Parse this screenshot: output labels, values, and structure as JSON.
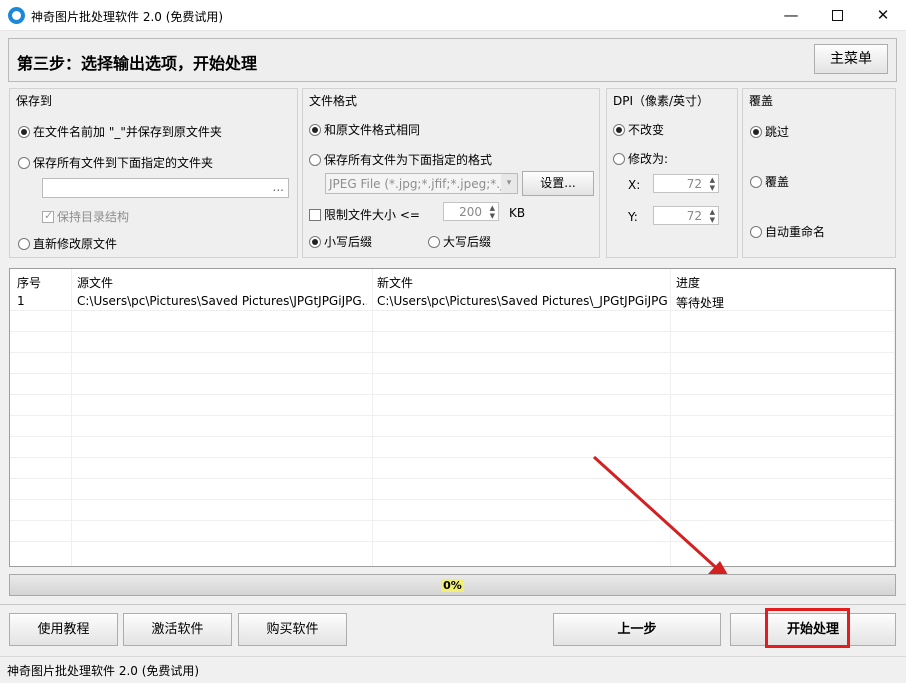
{
  "window": {
    "title": "神奇图片批处理软件 2.0 (免费试用)",
    "minimize_icon": "minimize-icon",
    "maximize_icon": "maximize-icon",
    "close_icon": "close-icon"
  },
  "header": {
    "step_title": "第三步：选择输出选项，开始处理",
    "main_menu_label": "主菜单"
  },
  "save_to": {
    "title": "保存到",
    "option_prefix": "在文件名前加 \"_\"并保存到原文件夹",
    "option_folder": "保存所有文件到下面指定的文件夹",
    "folder_value": "",
    "browse_label": "...",
    "keep_structure": "保持目录结构",
    "option_overwrite": "直新修改原文件"
  },
  "file_format": {
    "title": "文件格式",
    "option_same": "和原文件格式相同",
    "option_specified": "保存所有文件为下面指定的格式",
    "format_select": "JPEG File (*.jpg;*.jfif;*.jpeg;*.j",
    "settings_label": "设置...",
    "limit_size_label": "限制文件大小  <=",
    "limit_size_value": "200",
    "limit_size_unit": "KB",
    "lowercase_ext": "小写后缀",
    "uppercase_ext": "大写后缀"
  },
  "dpi": {
    "title": "DPI（像素/英寸）",
    "no_change": "不改变",
    "change_to": "修改为:",
    "x_label": "X:",
    "x_value": "72",
    "y_label": "Y:",
    "y_value": "72"
  },
  "overwrite": {
    "title": "覆盖",
    "skip": "跳过",
    "cover": "覆盖",
    "auto_rename": "自动重命名"
  },
  "table": {
    "headers": [
      "序号",
      "源文件",
      "新文件",
      "进度"
    ],
    "rows": [
      {
        "index": "1",
        "source": "C:\\Users\\pc\\Pictures\\Saved Pictures\\JPGtJPGiJPG...",
        "target": "C:\\Users\\pc\\Pictures\\Saved Pictures\\_JPGtJPGiJPG...",
        "status": "等待处理"
      }
    ]
  },
  "progress": {
    "label": "0%",
    "fraction": 0
  },
  "footer": {
    "tutorial": "使用教程",
    "activate": "激活软件",
    "buy": "购买软件",
    "prev": "上一步",
    "start": "开始处理"
  },
  "statusbar": {
    "text": "神奇图片批处理软件 2.0 (免费试用)"
  },
  "colors": {
    "highlight": "#e11d1d",
    "arrow": "#d42020",
    "progress_label_bg": "#f1ee70"
  }
}
